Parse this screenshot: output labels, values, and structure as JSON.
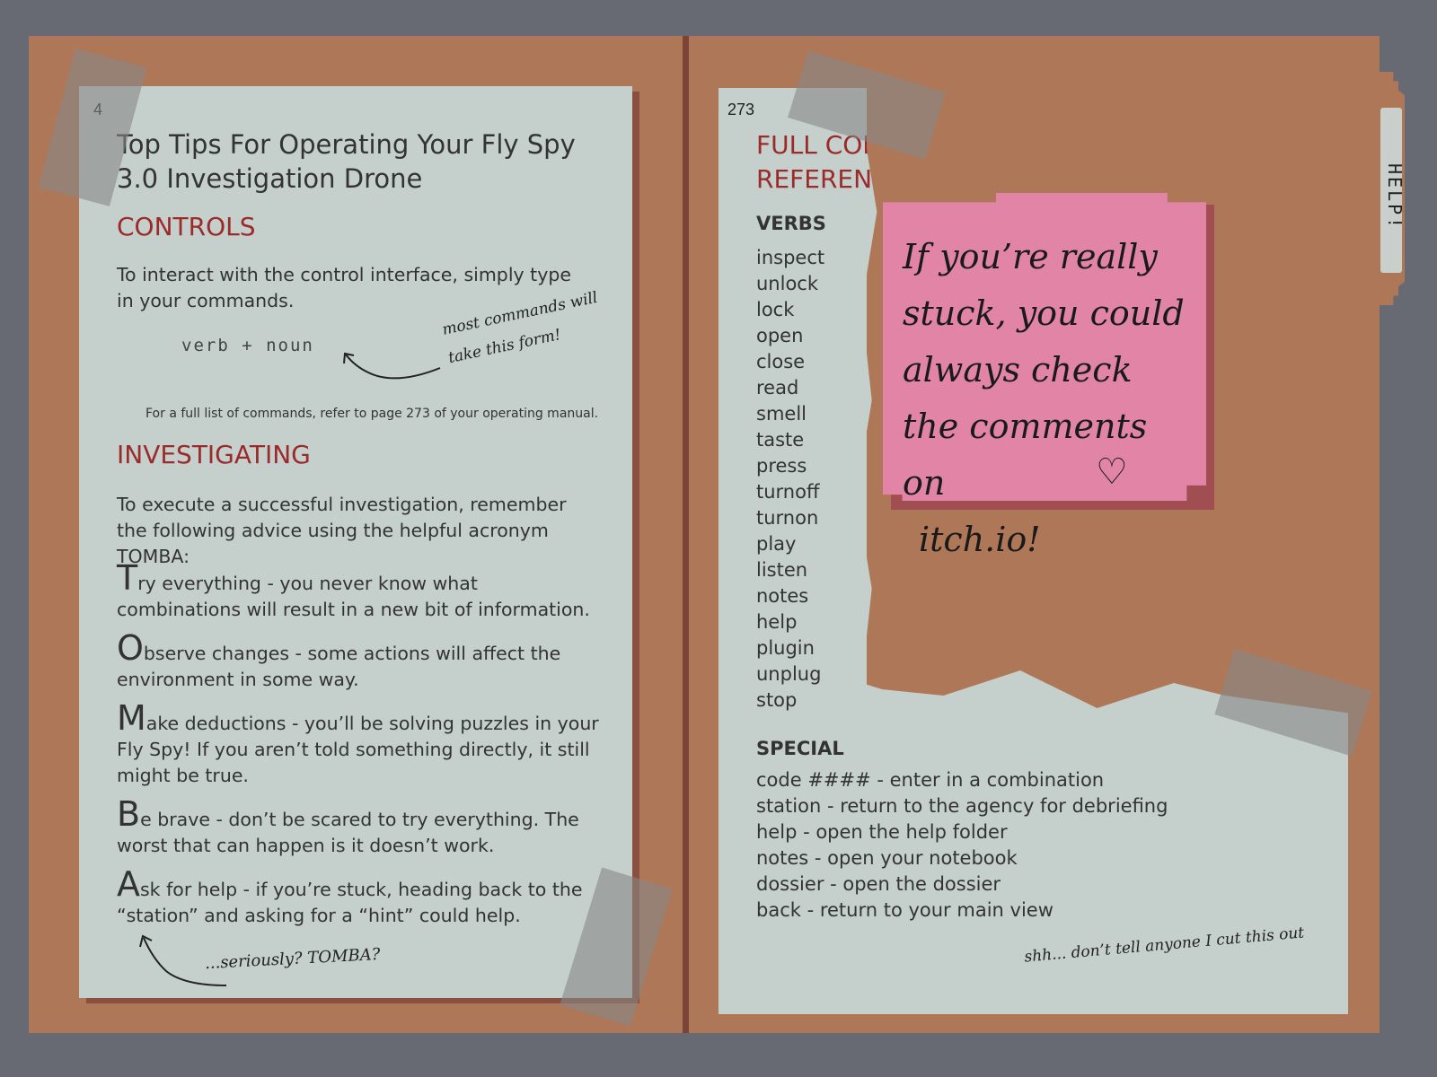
{
  "left_page": {
    "page_number": "4",
    "title": "Top Tips For Operating Your Fly Spy 3.0 Investigation Drone",
    "controls_heading": "CONTROLS",
    "controls_text": "To interact with the control interface, simply type in your commands.",
    "command_form": "verb + noun",
    "note_command_form": "most commands will take this form!",
    "reference_note": "For a full list of commands, refer to page 273 of your operating manual.",
    "investigating_heading": "INVESTIGATING",
    "investigating_text": "To execute a successful investigation, remember the following advice using the helpful acronym TOMBA:",
    "tips": [
      {
        "letter": "T",
        "text": "ry everything - you never know what combinations will result in a new bit of information."
      },
      {
        "letter": "O",
        "text": "bserve changes - some actions will affect the environment in some way."
      },
      {
        "letter": "M",
        "text": "ake deductions - you’ll be solving puzzles in your Fly Spy! If you aren’t told something directly, it still might be true."
      },
      {
        "letter": "B",
        "text": "e brave - don’t be scared to try everything. The worst that can happen is it doesn’t work."
      },
      {
        "letter": "A",
        "text": "sk for help - if you’re stuck, heading back to the “station” and asking for a “hint” could help."
      }
    ],
    "note_tomba": "...seriously? TOMBA?"
  },
  "right_page": {
    "page_number": "273",
    "title_line1": "FULL COM",
    "title_line2": "REFERENC",
    "verbs_heading": "VERBS",
    "verbs": [
      "inspect",
      "unlock",
      "lock",
      "open",
      "close",
      "read",
      "smell",
      "taste",
      "press",
      "turnoff",
      "turnon",
      "play",
      "listen",
      "notes",
      "help",
      "plugin",
      "unplug",
      "stop"
    ],
    "special_heading": "SPECIAL",
    "special": [
      "code #### - enter in a combination",
      "station - return to the agency for debriefing",
      "help - open the help folder",
      "notes - open your notebook",
      "dossier - open the dossier",
      "back - return to your main view"
    ],
    "note_cut": "shh... don’t tell anyone I cut this out"
  },
  "sticky_note": {
    "lines": [
      "If you’re really",
      "stuck, you could",
      "always check",
      "the comments on",
      "itch.io!"
    ],
    "heart": "♡"
  },
  "folder_tab": {
    "label": "HELP!"
  },
  "colors": {
    "background": "#676a72",
    "folder": "#ae7757",
    "paper": "#c5cfcc",
    "heading_red": "#9b2a2a",
    "sticky": "#e184a6"
  }
}
